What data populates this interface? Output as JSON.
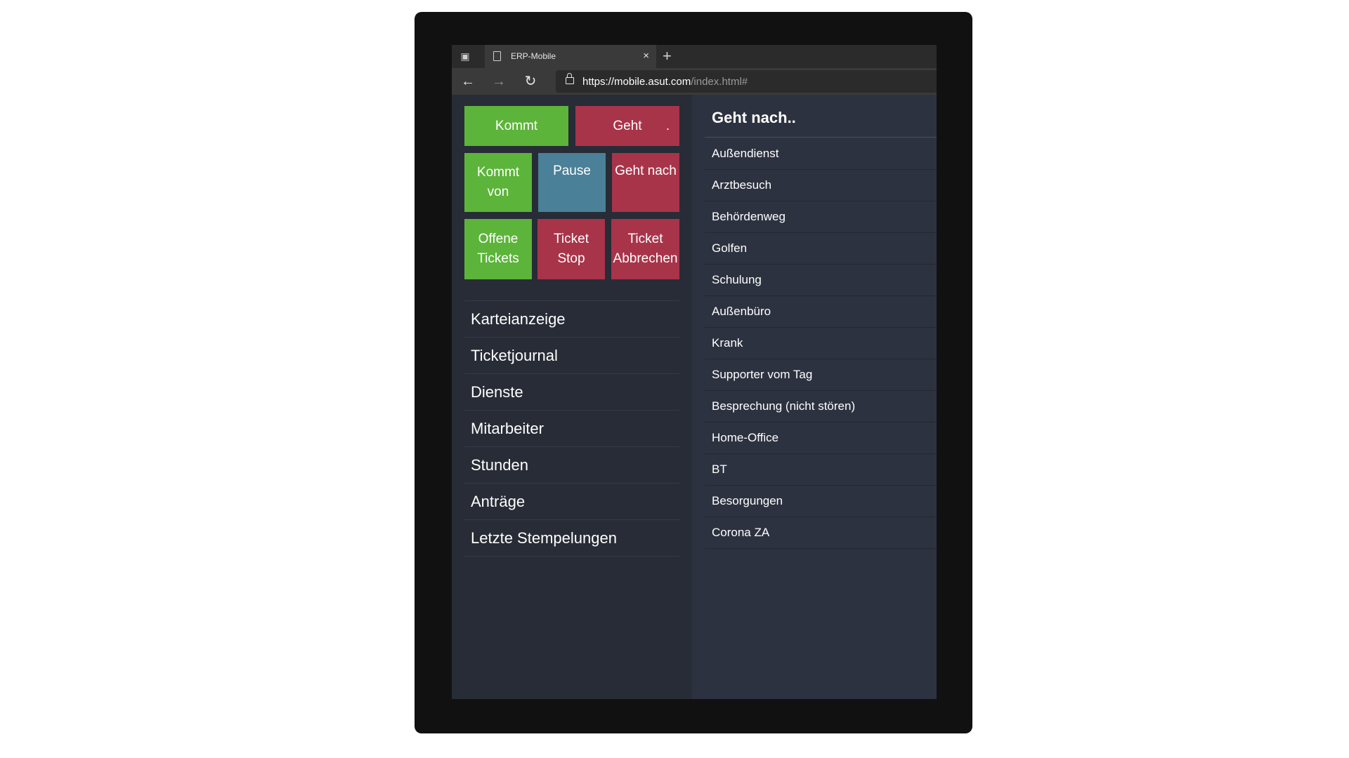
{
  "browser": {
    "tab_title": "ERP-Mobile",
    "tab_close": "×",
    "new_tab": "+",
    "back": "←",
    "forward": "→",
    "reload": "↻",
    "url_scheme": "https://",
    "url_host": "mobile.asut.com",
    "url_path": "/index.html#"
  },
  "actions": {
    "kommt": "Kommt",
    "geht": "Geht",
    "geht_dot": ".",
    "kommt_von": "Kommt von",
    "pause": "Pause",
    "geht_nach": "Geht nach",
    "offene_tickets": "Offene Tickets",
    "ticket_stop": "Ticket Stop",
    "ticket_abbrechen": "Ticket Abbrechen"
  },
  "menu": {
    "items": [
      "Karteianzeige",
      "Ticketjournal",
      "Dienste",
      "Mitarbeiter",
      "Stunden",
      "Anträge",
      "Letzte Stempelungen"
    ]
  },
  "geht_nach_panel": {
    "title": "Geht nach..",
    "items": [
      "Außendienst",
      "Arztbesuch",
      "Behördenweg",
      "Golfen",
      "Schulung",
      "Außenbüro",
      "Krank",
      "Supporter vom Tag",
      "Besprechung (nicht stören)",
      "Home-Office",
      "BT",
      "Besorgungen",
      "Corona ZA"
    ]
  },
  "colors": {
    "green": "#5cb43a",
    "red": "#a8344a",
    "blue": "#4a8098",
    "background": "#272c36",
    "panel": "#2d3240"
  }
}
